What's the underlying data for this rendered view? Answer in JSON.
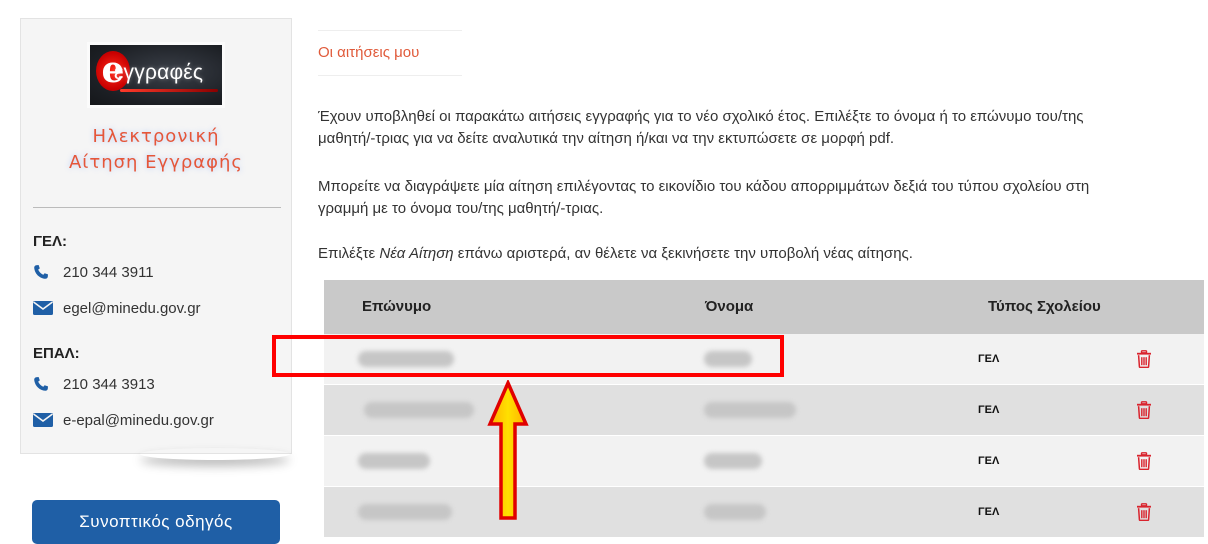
{
  "sidebar": {
    "logo_text": "εγγραφές",
    "title_line1": "Ηλεκτρονική",
    "title_line2": "Αίτηση Εγγραφής",
    "contacts": [
      {
        "heading": "ΓΕΛ:",
        "phone": "210 344 3911",
        "email": "egel@minedu.gov.gr"
      },
      {
        "heading": "ΕΠΑΛ:",
        "phone": "210 344 3913",
        "email": "e-epal@minedu.gov.gr"
      }
    ],
    "guide_button": "Συνοπτικός οδηγός"
  },
  "main": {
    "breadcrumb": "Οι αιτήσεις μου",
    "para1_line1": "Έχουν υποβληθεί οι παρακάτω αιτήσεις εγγραφής για το νέο σχολικό έτος. Επιλέξτε το όνομα ή το επώνυμο του/της",
    "para1_line2": "μαθητή/-τριας για να δείτε αναλυτικά την αίτηση ή/και να την εκτυπώσετε σε μορφή pdf.",
    "para2_line1": "Μπορείτε να διαγράψετε μία αίτηση επιλέγοντας το εικονίδιο του κάδου απορριμμάτων δεξιά του τύπου σχολείου στη",
    "para2_line2": "γραμμή με το όνομα του/της μαθητή/-τριας.",
    "para3_before": "Επιλέξτε ",
    "para3_em": "Νέα Αίτηση",
    "para3_after": " επάνω αριστερά, αν θέλετε να ξεκινήσετε την υποβολή νέας αίτησης."
  },
  "table": {
    "headers": [
      "Επώνυμο",
      "Όνομα",
      "Τύπος Σχολείου"
    ],
    "rows": [
      {
        "surname": "",
        "name": "",
        "school_type": "ΓΕΛ"
      },
      {
        "surname": "",
        "name": "",
        "school_type": "ΓΕΛ"
      },
      {
        "surname": "",
        "name": "",
        "school_type": "ΓΕΛ"
      },
      {
        "surname": "",
        "name": "",
        "school_type": "ΓΕΛ"
      }
    ]
  },
  "colors": {
    "accent": "#e05a3a",
    "header_bg": "#c9c9c9",
    "trash": "#d9232d",
    "highlight": "#ff0000",
    "arrow_fill": "#ffd400",
    "guide_button_bg": "#1f5fa6"
  },
  "icons": [
    "phone-icon",
    "envelope-icon",
    "trash-icon"
  ]
}
